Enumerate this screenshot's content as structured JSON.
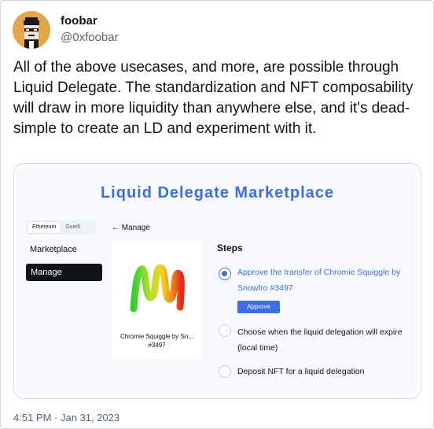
{
  "author": {
    "display_name": "foobar",
    "handle": "@0xfoobar"
  },
  "tweet": {
    "text": "All of the above usecases, and more, are possible through Liquid Delegate. The standardization and NFT composability will draw in more liquidity than anywhere else, and it's dead-simple to create an LD and experiment with it.",
    "timestamp": "4:51 PM · Jan 31, 2023"
  },
  "embed": {
    "title": "Liquid Delegate Marketplace",
    "networks": [
      "Ethereum",
      "Goerli"
    ],
    "nav": {
      "marketplace": "Marketplace",
      "manage": "Manage"
    },
    "back_label": "← Manage",
    "nft": {
      "caption": "Chromie Squiggle by Sn... #3497"
    },
    "steps": {
      "title": "Steps",
      "items": [
        "Approve the transfer of Chromie Squiggle by Snowfro #3497",
        "Choose when the liquid delegation will expire (local time)",
        "Deposit NFT for a liquid delegation"
      ],
      "approve_label": "Approve"
    }
  },
  "colors": {
    "accent": "#3a6ee8",
    "dark": "#0f1419",
    "muted": "#536471",
    "avatar_bg": "#e8a64a"
  },
  "icons": {
    "avatar": "pixel-punk-avatar",
    "nft": "chromie-squiggle-art"
  }
}
